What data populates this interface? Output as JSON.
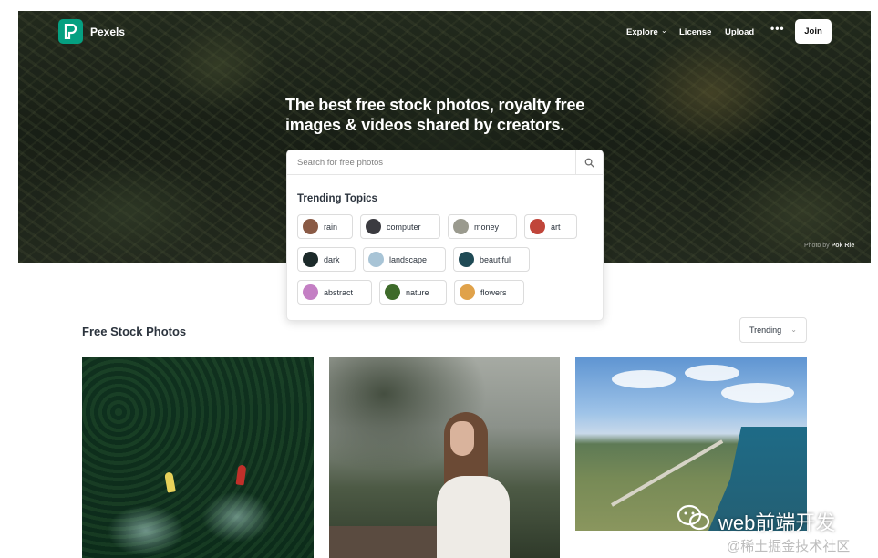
{
  "brand": {
    "name": "Pexels",
    "color": "#05a081"
  },
  "nav": {
    "explore": "Explore",
    "license": "License",
    "upload": "Upload",
    "more": "•••",
    "join": "Join"
  },
  "hero": {
    "title": "The best free stock photos, royalty free images & videos shared by creators.",
    "credit_prefix": "Photo by",
    "credit_name": "Pok Rie"
  },
  "search": {
    "placeholder": "Search for free photos",
    "trending_title": "Trending Topics",
    "topics": [
      {
        "label": "rain",
        "color": "#8a5a45"
      },
      {
        "label": "computer",
        "color": "#3b3b40"
      },
      {
        "label": "money",
        "color": "#9a9a8e"
      },
      {
        "label": "art",
        "color": "#c0453a"
      },
      {
        "label": "dark",
        "color": "#1c2a2a"
      },
      {
        "label": "landscape",
        "color": "#a8c4d6"
      },
      {
        "label": "beautiful",
        "color": "#1f4a55"
      },
      {
        "label": "abstract",
        "color": "#c47fc4"
      },
      {
        "label": "nature",
        "color": "#3e6b2a"
      },
      {
        "label": "flowers",
        "color": "#e0a24a"
      }
    ]
  },
  "section": {
    "title": "Free Stock Photos",
    "sort": "Trending"
  },
  "watermark": {
    "main": "web前端开发",
    "sub": "@稀土掘金技术社区"
  }
}
